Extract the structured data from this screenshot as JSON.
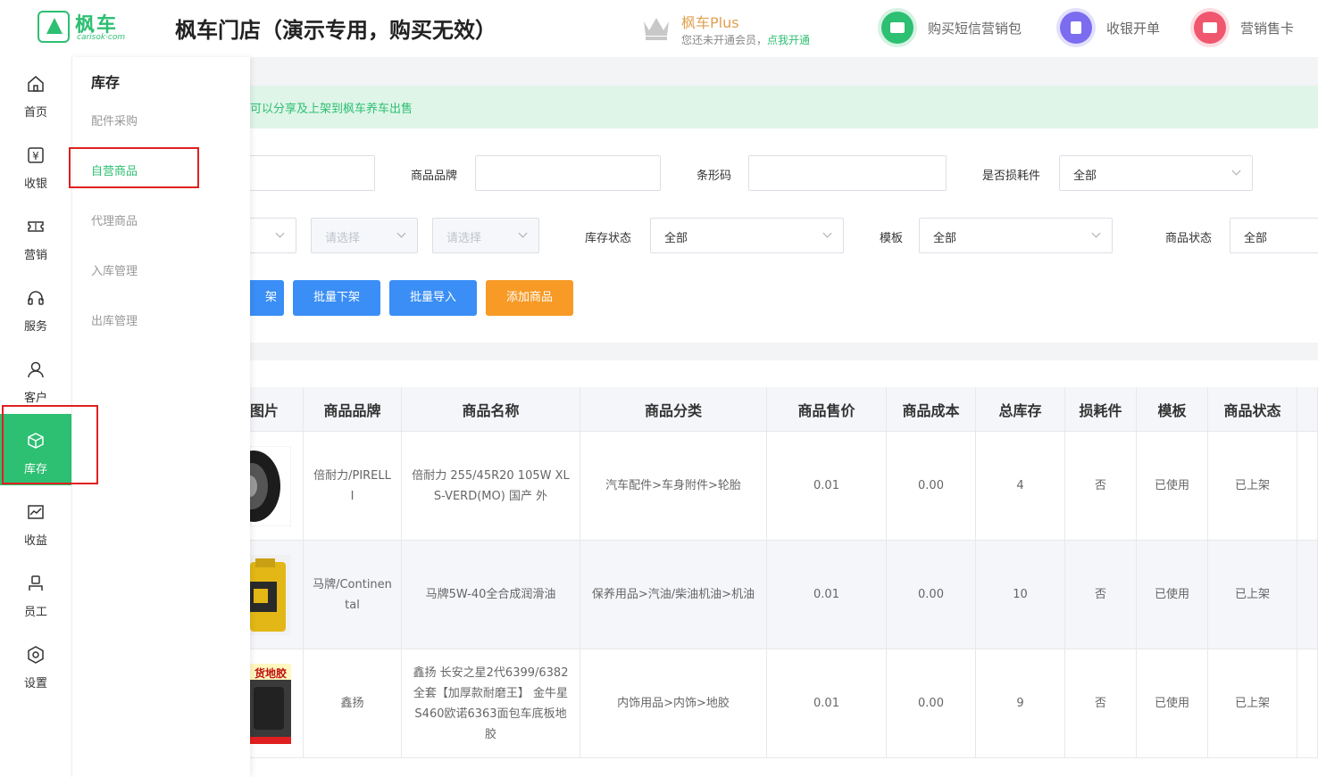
{
  "header": {
    "brand": "枫车",
    "domain": "carisok·com",
    "store_title": "枫车门店（演示专用，购买无效）",
    "plus_title": "枫车Plus",
    "plus_sub": "您还未开通会员，",
    "plus_link": "点我开通",
    "actions": [
      {
        "label": "购买短信营销包",
        "icon": "message-icon",
        "color": "#2dbf72"
      },
      {
        "label": "收银开单",
        "icon": "receipt-icon",
        "color": "#7b6cf0"
      },
      {
        "label": "营销售卡",
        "icon": "card-icon",
        "color": "#f0566e"
      }
    ]
  },
  "rail": [
    {
      "label": "首页",
      "icon": "home-icon"
    },
    {
      "label": "收银",
      "icon": "cashier-icon"
    },
    {
      "label": "营销",
      "icon": "ticket-icon"
    },
    {
      "label": "服务",
      "icon": "headset-icon"
    },
    {
      "label": "客户",
      "icon": "user-icon"
    },
    {
      "label": "库存",
      "icon": "box-icon",
      "active": true
    },
    {
      "label": "收益",
      "icon": "chart-icon"
    },
    {
      "label": "员工",
      "icon": "staff-icon"
    },
    {
      "label": "设置",
      "icon": "settings-icon"
    }
  ],
  "submenu": {
    "title": "库存",
    "items": [
      "配件采购",
      "自营商品",
      "代理商品",
      "入库管理",
      "出库管理"
    ],
    "active_index": 1
  },
  "notice": "可以分享及上架到枫车养车出售",
  "filters": {
    "brand_label": "商品品牌",
    "barcode_label": "条形码",
    "consumable_label": "是否损耗件",
    "consumable_value": "全部",
    "select_placeholder": "请选择",
    "stock_status_label": "库存状态",
    "stock_status_value": "全部",
    "template_label": "模板",
    "template_value": "全部",
    "goods_status_label": "商品状态",
    "goods_status_value": "全部"
  },
  "buttons": {
    "batch_on_partial": "架",
    "batch_off": "批量下架",
    "batch_import": "批量导入",
    "add_goods": "添加商品"
  },
  "colors": {
    "accent": "#2dbf72",
    "blue": "#3a8ef6",
    "orange": "#f79a26"
  },
  "table": {
    "columns": [
      "图片",
      "商品品牌",
      "商品名称",
      "商品分类",
      "商品售价",
      "商品成本",
      "总库存",
      "损耗件",
      "模板",
      "商品状态"
    ],
    "rows": [
      {
        "brand": "倍耐力/PIRELLI",
        "name": "倍耐力 255/45R20 105W XL S-VERD(MO) 国产 外",
        "category": "汽车配件>车身附件>轮胎",
        "price": "0.01",
        "cost": "0.00",
        "stock": "4",
        "consumable": "否",
        "template": "已使用",
        "status": "已上架",
        "img": "tire-image"
      },
      {
        "brand": "马牌/Continental",
        "name": "马牌5W-40全合成润滑油",
        "category": "保养用品>汽油/柴油机油>机油",
        "price": "0.01",
        "cost": "0.00",
        "stock": "10",
        "consumable": "否",
        "template": "已使用",
        "status": "已上架",
        "img": "oil-image"
      },
      {
        "brand": "鑫扬",
        "name": "鑫扬 长安之星2代6399/6382全套【加厚款耐磨王】 金牛星S460欧诺6363面包车底板地胶",
        "category": "内饰用品>内饰>地胶",
        "price": "0.01",
        "cost": "0.00",
        "stock": "9",
        "consumable": "否",
        "template": "已使用",
        "status": "已上架",
        "img": "mat-image",
        "img_text": "货地胶"
      }
    ]
  }
}
